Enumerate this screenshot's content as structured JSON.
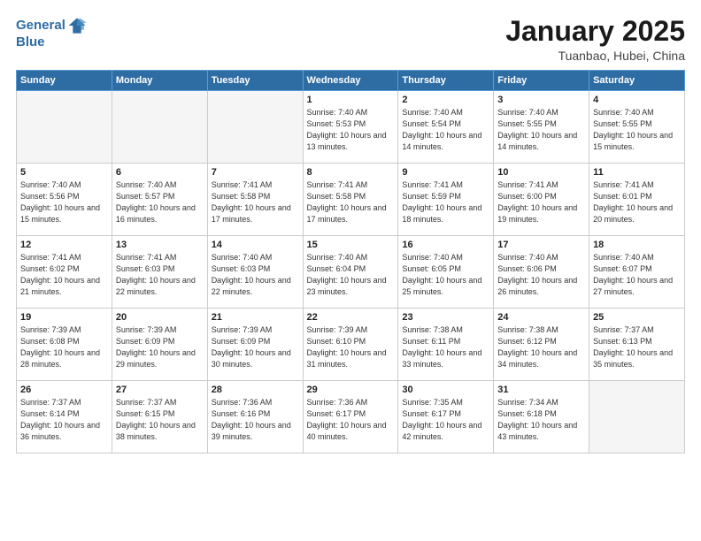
{
  "header": {
    "logo_line1": "General",
    "logo_line2": "Blue",
    "title": "January 2025",
    "subtitle": "Tuanbao, Hubei, China"
  },
  "days_of_week": [
    "Sunday",
    "Monday",
    "Tuesday",
    "Wednesday",
    "Thursday",
    "Friday",
    "Saturday"
  ],
  "weeks": [
    [
      {
        "num": "",
        "empty": true
      },
      {
        "num": "",
        "empty": true
      },
      {
        "num": "",
        "empty": true
      },
      {
        "num": "1",
        "sunrise": "7:40 AM",
        "sunset": "5:53 PM",
        "daylight": "10 hours and 13 minutes."
      },
      {
        "num": "2",
        "sunrise": "7:40 AM",
        "sunset": "5:54 PM",
        "daylight": "10 hours and 14 minutes."
      },
      {
        "num": "3",
        "sunrise": "7:40 AM",
        "sunset": "5:55 PM",
        "daylight": "10 hours and 14 minutes."
      },
      {
        "num": "4",
        "sunrise": "7:40 AM",
        "sunset": "5:55 PM",
        "daylight": "10 hours and 15 minutes."
      }
    ],
    [
      {
        "num": "5",
        "sunrise": "7:40 AM",
        "sunset": "5:56 PM",
        "daylight": "10 hours and 15 minutes."
      },
      {
        "num": "6",
        "sunrise": "7:40 AM",
        "sunset": "5:57 PM",
        "daylight": "10 hours and 16 minutes."
      },
      {
        "num": "7",
        "sunrise": "7:41 AM",
        "sunset": "5:58 PM",
        "daylight": "10 hours and 17 minutes."
      },
      {
        "num": "8",
        "sunrise": "7:41 AM",
        "sunset": "5:58 PM",
        "daylight": "10 hours and 17 minutes."
      },
      {
        "num": "9",
        "sunrise": "7:41 AM",
        "sunset": "5:59 PM",
        "daylight": "10 hours and 18 minutes."
      },
      {
        "num": "10",
        "sunrise": "7:41 AM",
        "sunset": "6:00 PM",
        "daylight": "10 hours and 19 minutes."
      },
      {
        "num": "11",
        "sunrise": "7:41 AM",
        "sunset": "6:01 PM",
        "daylight": "10 hours and 20 minutes."
      }
    ],
    [
      {
        "num": "12",
        "sunrise": "7:41 AM",
        "sunset": "6:02 PM",
        "daylight": "10 hours and 21 minutes."
      },
      {
        "num": "13",
        "sunrise": "7:41 AM",
        "sunset": "6:03 PM",
        "daylight": "10 hours and 22 minutes."
      },
      {
        "num": "14",
        "sunrise": "7:40 AM",
        "sunset": "6:03 PM",
        "daylight": "10 hours and 22 minutes."
      },
      {
        "num": "15",
        "sunrise": "7:40 AM",
        "sunset": "6:04 PM",
        "daylight": "10 hours and 23 minutes."
      },
      {
        "num": "16",
        "sunrise": "7:40 AM",
        "sunset": "6:05 PM",
        "daylight": "10 hours and 25 minutes."
      },
      {
        "num": "17",
        "sunrise": "7:40 AM",
        "sunset": "6:06 PM",
        "daylight": "10 hours and 26 minutes."
      },
      {
        "num": "18",
        "sunrise": "7:40 AM",
        "sunset": "6:07 PM",
        "daylight": "10 hours and 27 minutes."
      }
    ],
    [
      {
        "num": "19",
        "sunrise": "7:39 AM",
        "sunset": "6:08 PM",
        "daylight": "10 hours and 28 minutes."
      },
      {
        "num": "20",
        "sunrise": "7:39 AM",
        "sunset": "6:09 PM",
        "daylight": "10 hours and 29 minutes."
      },
      {
        "num": "21",
        "sunrise": "7:39 AM",
        "sunset": "6:09 PM",
        "daylight": "10 hours and 30 minutes."
      },
      {
        "num": "22",
        "sunrise": "7:39 AM",
        "sunset": "6:10 PM",
        "daylight": "10 hours and 31 minutes."
      },
      {
        "num": "23",
        "sunrise": "7:38 AM",
        "sunset": "6:11 PM",
        "daylight": "10 hours and 33 minutes."
      },
      {
        "num": "24",
        "sunrise": "7:38 AM",
        "sunset": "6:12 PM",
        "daylight": "10 hours and 34 minutes."
      },
      {
        "num": "25",
        "sunrise": "7:37 AM",
        "sunset": "6:13 PM",
        "daylight": "10 hours and 35 minutes."
      }
    ],
    [
      {
        "num": "26",
        "sunrise": "7:37 AM",
        "sunset": "6:14 PM",
        "daylight": "10 hours and 36 minutes."
      },
      {
        "num": "27",
        "sunrise": "7:37 AM",
        "sunset": "6:15 PM",
        "daylight": "10 hours and 38 minutes."
      },
      {
        "num": "28",
        "sunrise": "7:36 AM",
        "sunset": "6:16 PM",
        "daylight": "10 hours and 39 minutes."
      },
      {
        "num": "29",
        "sunrise": "7:36 AM",
        "sunset": "6:17 PM",
        "daylight": "10 hours and 40 minutes."
      },
      {
        "num": "30",
        "sunrise": "7:35 AM",
        "sunset": "6:17 PM",
        "daylight": "10 hours and 42 minutes."
      },
      {
        "num": "31",
        "sunrise": "7:34 AM",
        "sunset": "6:18 PM",
        "daylight": "10 hours and 43 minutes."
      },
      {
        "num": "",
        "empty": true
      }
    ]
  ]
}
